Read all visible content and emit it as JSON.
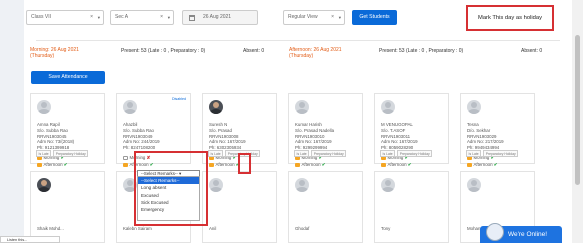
{
  "filters": {
    "class_value": "Class VII",
    "section_value": "Sec A",
    "date_value": "26 Aug 2021",
    "view_value": "Regular View",
    "get_students_label": "Get Students",
    "clear_symbol": "×",
    "caret_symbol": "▾"
  },
  "holiday_label": "Mark This day as holiday",
  "morning": {
    "heading_line1": "Morning: 26 Aug 2021",
    "heading_line2": "(Thursday)",
    "present": "Present: 53 (Late : 0 , Preparatory : 0)",
    "absent": "Absent: 0"
  },
  "afternoon": {
    "heading_line1": "Afternoon: 26 Aug 2021",
    "heading_line2": "(Thursday)",
    "present": "Present: 53 (Late : 0 , Preparatory : 0)",
    "absent": "Absent: 0"
  },
  "save_label": "Save Attendance",
  "labels": {
    "morning": "Morning",
    "afternoon": "Afternoon",
    "tag_late": "Is Late",
    "tag_prep": "Preparatory Holiday",
    "disabled": "Disabled"
  },
  "students": [
    {
      "name": "Amna Rapil",
      "parent": "S/o. Subba Rao",
      "reg": "RRVN1903045",
      "adm": "Adm No: 73/(2018)",
      "phone": "Ph: 9121399918",
      "morning": true,
      "afternoon": true
    },
    {
      "name": "Ahazbil",
      "parent": "S/o. Subba Rao",
      "reg": "RRVN1903049",
      "adm": "Adm No: 244/2019",
      "phone": "Ph: 8247108200",
      "morning": false,
      "afternoon": true
    },
    {
      "name": "Suresh N",
      "parent": "S/o. Prasad",
      "reg": "RRVN1903008",
      "adm": "Adm No: 167/2019",
      "phone": "Ph: 6302305934",
      "morning": true,
      "afternoon": true
    },
    {
      "name": "Kumar Harish",
      "parent": "S/o. Prasad Nadella",
      "reg": "RRVN1903010",
      "adm": "Adm No: 167/2019",
      "phone": "Ph: 9299299994",
      "morning": true,
      "afternoon": true
    },
    {
      "name": "M VENUGOPAL",
      "parent": "S/o. T.ASOF",
      "reg": "RRVN1903011",
      "adm": "Adm No: 167/2019",
      "phone": "Ph: 8059028290",
      "morning": true,
      "afternoon": true
    },
    {
      "name": "Tesna",
      "parent": "D/o. Sekhar",
      "reg": "RRVN1903029",
      "adm": "Adm No: 217/2019",
      "phone": "Ph: 9949434994",
      "morning": true,
      "afternoon": true
    }
  ],
  "remarks": {
    "selected": "--Select Remarks-- ▾",
    "options": [
      "--Select Remarks--",
      "Long absent",
      "Excused",
      "Sick Excused",
      "Emergency"
    ]
  },
  "second_row_names": [
    "Shaik Mohd...",
    "Kalebn Sairam",
    "Anil",
    "Ghodaf",
    "Tony",
    "Mohan..."
  ],
  "chat_label": "We're Online!",
  "listen_label": "Listen this..."
}
